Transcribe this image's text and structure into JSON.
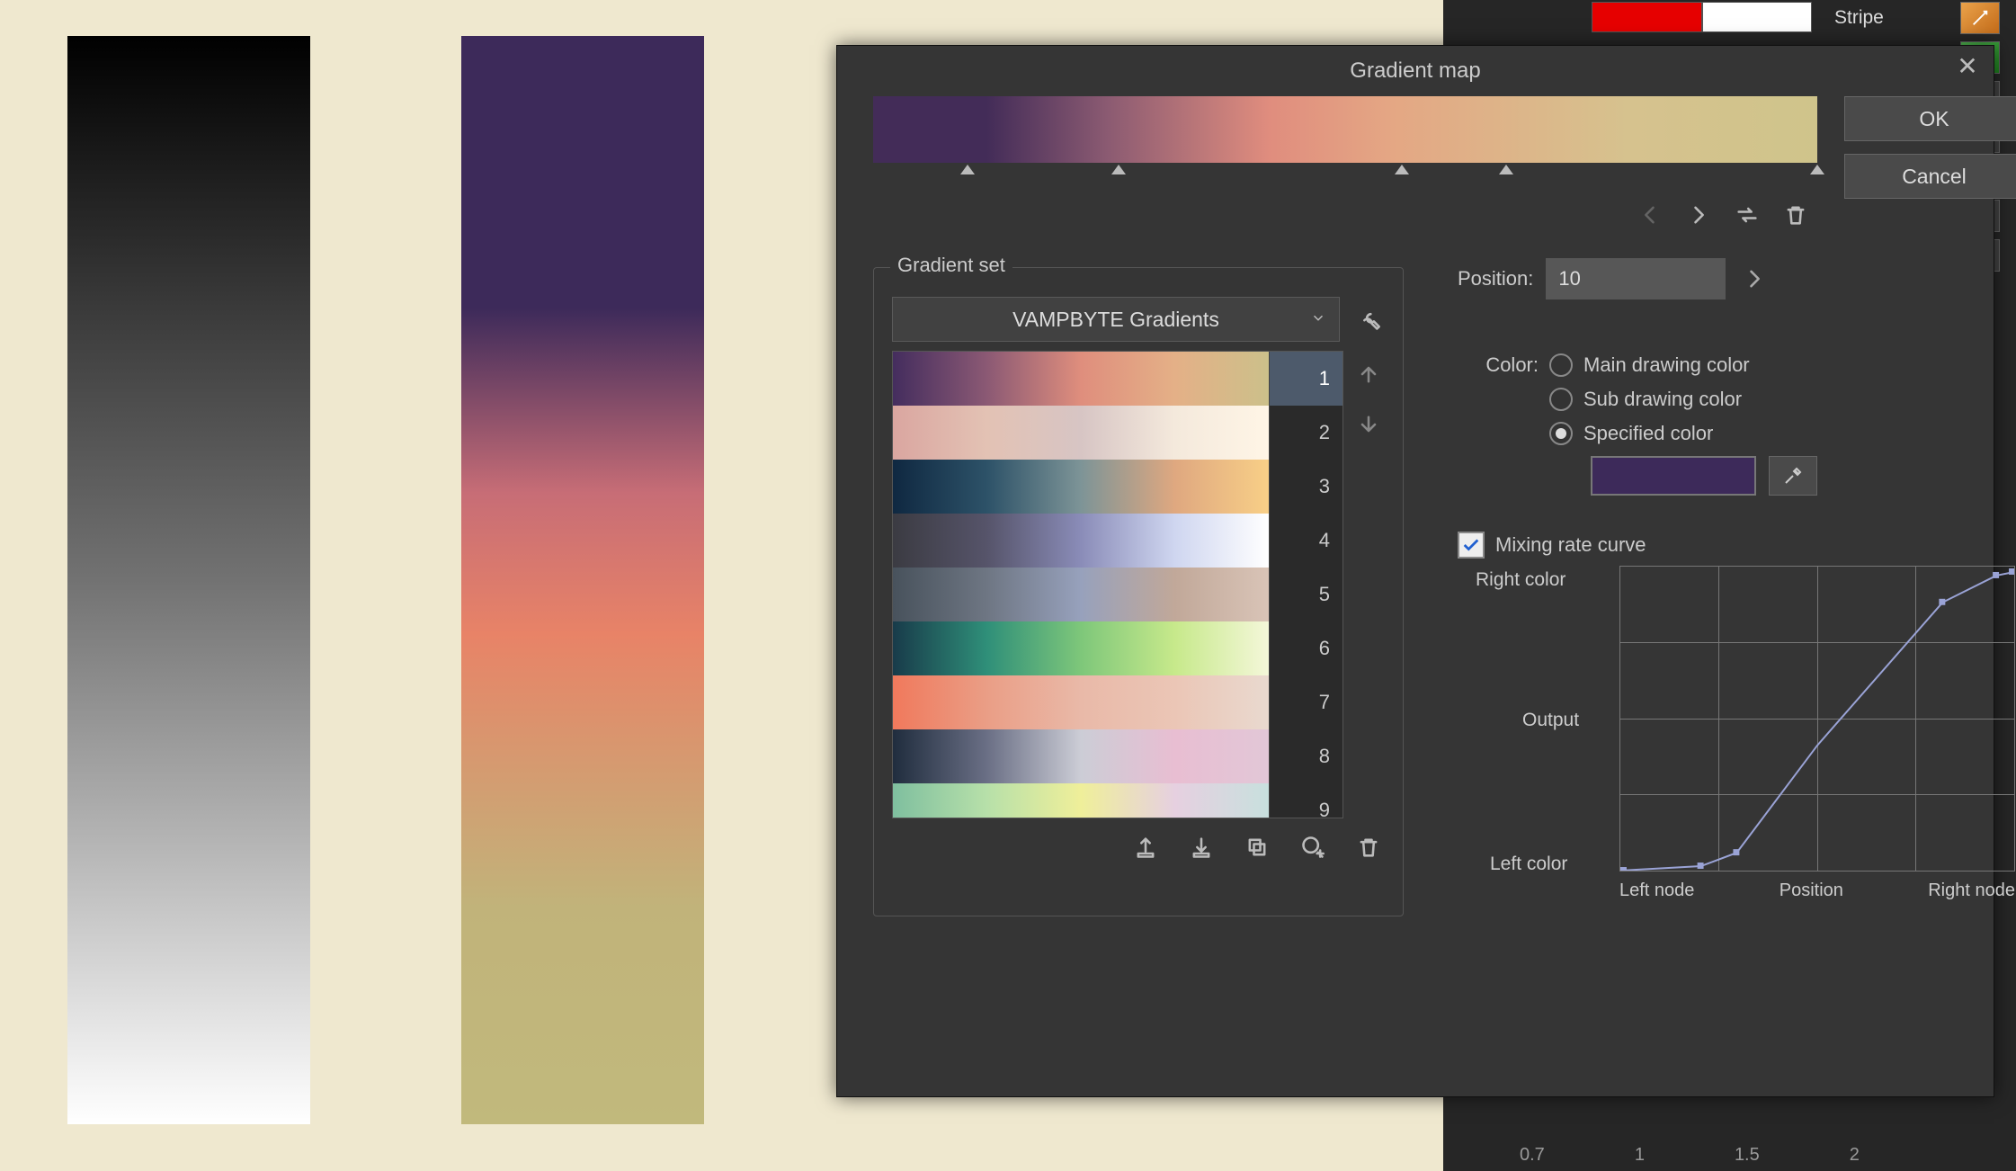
{
  "canvas": {},
  "background_ui": {
    "stripe_label": "Stripe",
    "slider_ticks": [
      "0.7",
      "1",
      "1.5",
      "2"
    ]
  },
  "dialog": {
    "title": "Gradient map",
    "ok_label": "OK",
    "cancel_label": "Cancel",
    "preview_stops_pct": [
      10,
      26,
      56,
      67,
      100
    ],
    "gradient_set": {
      "legend": "Gradient set",
      "selected_set": "VAMPBYTE Gradients",
      "list": [
        {
          "n": "1",
          "css": "linear-gradient(to right,#442d5e,#8b5974,#df8e7d,#e4b087,#ccc08a)",
          "selected": true
        },
        {
          "n": "2",
          "css": "linear-gradient(to right,#daa6a0,#e3c2b4,#d7c5c4,#f4e9dc,#fff5e6)"
        },
        {
          "n": "3",
          "css": "linear-gradient(to right,#0f2841,#2d5268,#7d9497,#dfa880,#f8cf87)"
        },
        {
          "n": "4",
          "css": "linear-gradient(to right,#3b3b42,#56546a,#8a8cb8,#cfd6f0,#ffffff)"
        },
        {
          "n": "5",
          "css": "linear-gradient(to right,#48525c,#6e7683,#97a1bc,#c1a899,#d9c4b7)"
        },
        {
          "n": "6",
          "css": "linear-gradient(to right,#183b4a,#2f8f79,#7ec77a,#c7e98b,#f4f7d9)"
        },
        {
          "n": "7",
          "css": "linear-gradient(to right,#f0795c,#ea9e86,#e9b9a8,#ebc6b6,#e9d9cf)"
        },
        {
          "n": "8",
          "css": "linear-gradient(to right,#202d3e,#6a6f85,#cccdd6,#e8bed2,#e2c7d7)"
        },
        {
          "n": "9",
          "css": "linear-gradient(to right,#7fbf9f,#b7e0a9,#efef9a,#e6d0e0,#c8e0de)"
        }
      ]
    },
    "position": {
      "label": "Position:",
      "value": "10"
    },
    "color": {
      "label": "Color:",
      "options": {
        "main": "Main drawing color",
        "sub": "Sub drawing color",
        "specified": "Specified color"
      },
      "selected": "specified",
      "specified_hex": "#3d2a5a"
    },
    "mixing": {
      "label": "Mixing rate curve",
      "checked": true,
      "y_top": "Right color",
      "y_mid": "Output",
      "y_bot": "Left color",
      "x_labels": [
        "Left node",
        "Position",
        "Right node"
      ]
    }
  }
}
